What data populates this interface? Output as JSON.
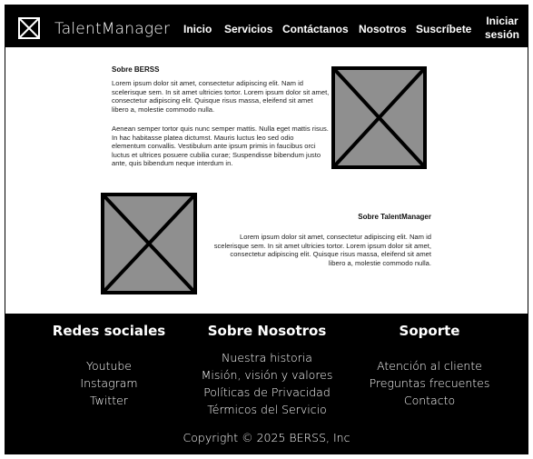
{
  "header": {
    "brand": "TalentManager",
    "logo_icon": "image-placeholder-icon",
    "nav": [
      "Inicio",
      "Servicios",
      "Contáctanos",
      "Nosotros",
      "Suscríbete"
    ],
    "login": [
      "Iniciar",
      "sesión"
    ]
  },
  "about_berss": {
    "title": "Sobre BERSS",
    "p1": "Lorem ipsum dolor sit amet, consectetur adipiscing elit. Nam id scelerisque sem. In sit amet ultricies tortor. Lorem ipsum dolor sit  amet, consectetur adipiscing elit. Quisque risus massa, eleifend sit  amet libero a, molestie commodo nulla.",
    "p2": "Aenean semper tortor quis nunc semper mattis. Nulla eget mattis risus.  In hac habitasse platea dictumst. Mauris luctus leo sed odio elementum  convallis. Vestibulum ante ipsum primis in faucibus orci luctus et  ultrices posuere cubilia curae; Suspendisse bibendum justo ante, quis  bibendum neque interdum in."
  },
  "about_tm": {
    "title": "Sobre TalentManager",
    "p1": "Lorem ipsum dolor sit amet, consectetur adipiscing elit. Nam id scelerisque sem. In sit amet ultricies tortor. Lorem ipsum dolor sit  amet, consectetur adipiscing elit. Quisque risus massa, eleifend sit  amet libero a, molestie commodo nulla."
  },
  "footer": {
    "social": {
      "title": "Redes sociales",
      "links": [
        "Youtube",
        "Instagram",
        "Twitter"
      ]
    },
    "about": {
      "title": "Sobre Nosotros",
      "links": [
        "Nuestra historia",
        "Misión, visión y valores",
        "Políticas de Privacidad",
        "Térmicos del Servicio"
      ]
    },
    "support": {
      "title": "Soporte",
      "links": [
        "Atención al cliente",
        "Preguntas frecuentes",
        "Contacto"
      ]
    },
    "copyright": "Copyright © 2025 BERSS, Inc"
  },
  "colors": {
    "header_bg": "#000000",
    "placeholder": "#8f8f8f"
  }
}
